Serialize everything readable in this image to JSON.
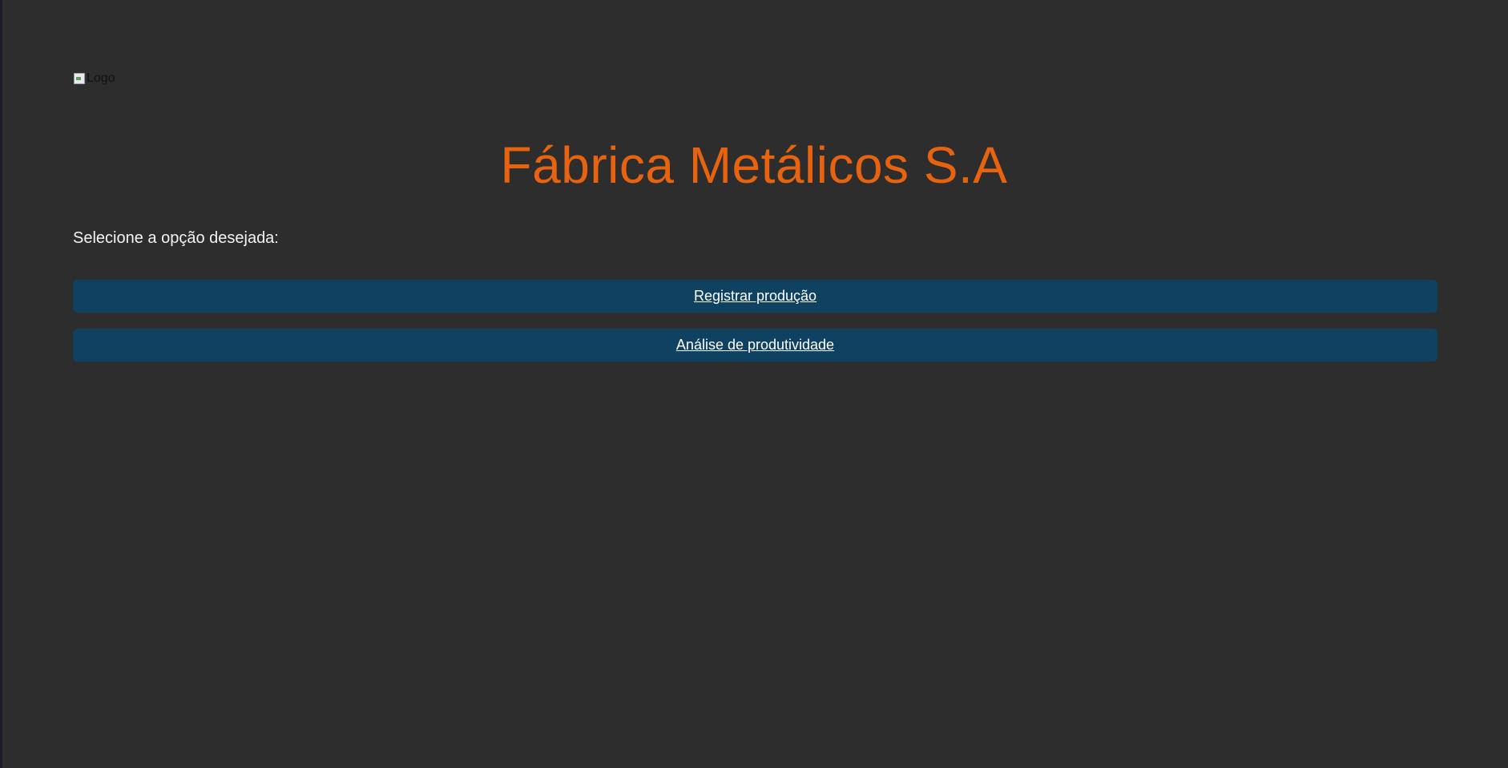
{
  "logo": {
    "alt_text": "Logo",
    "icon": "broken-image-icon"
  },
  "header": {
    "title": "Fábrica Metálicos S.A"
  },
  "main": {
    "prompt": "Selecione a opção desejada:",
    "options": [
      {
        "label": "Registrar produção"
      },
      {
        "label": "Análise de produtividade"
      }
    ]
  },
  "colors": {
    "background": "#2d2d2d",
    "title": "#e8630f",
    "button_bg": "#0f4261",
    "text": "#ffffff"
  }
}
